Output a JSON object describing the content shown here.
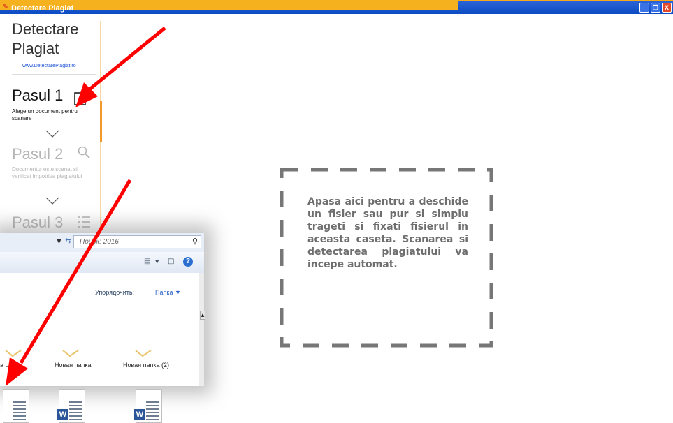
{
  "window": {
    "title": "Detectare Plagiat",
    "controls": [
      "_",
      "❐",
      "X"
    ]
  },
  "sidebar": {
    "brand_title": "Detectare Plagiat",
    "brand_link": "www.DetectarePlagiat.ro",
    "steps": [
      {
        "title": "Pasul 1",
        "icon": "document-icon",
        "description": "Alege un document pentru scanare",
        "active": true,
        "color": "#111111"
      },
      {
        "title": "Pasul 2",
        "icon": "magnifier-icon",
        "description": "Documentul este scanat si verificat impotriva plagiatului",
        "active": false,
        "color": "#b5b5b5"
      },
      {
        "title": "Pasul 3",
        "icon": "list-icon",
        "description": "",
        "active": false,
        "color": "#b5b5b5"
      }
    ]
  },
  "explorer": {
    "search_placeholder": "Поиск: 2016",
    "sort_label": "Упорядочить:",
    "sort_value": "Папка ▼",
    "folders": [
      "a usilor",
      "Новая папка",
      "Новая папка (2)"
    ],
    "documents": [
      "word-document",
      "word-document",
      "word-document"
    ]
  },
  "dropzone": {
    "text": "Apasa aici pentru a deschide un fisier sau pur si simplu trageti si fixati fisierul in aceasta caseta. Scanarea si detectarea plagiatului va incepe automat."
  },
  "colors": {
    "accent": "#f39a2a",
    "arrow": "#ff0000",
    "titlebar": "#1a56d1",
    "dash": "#777777"
  }
}
